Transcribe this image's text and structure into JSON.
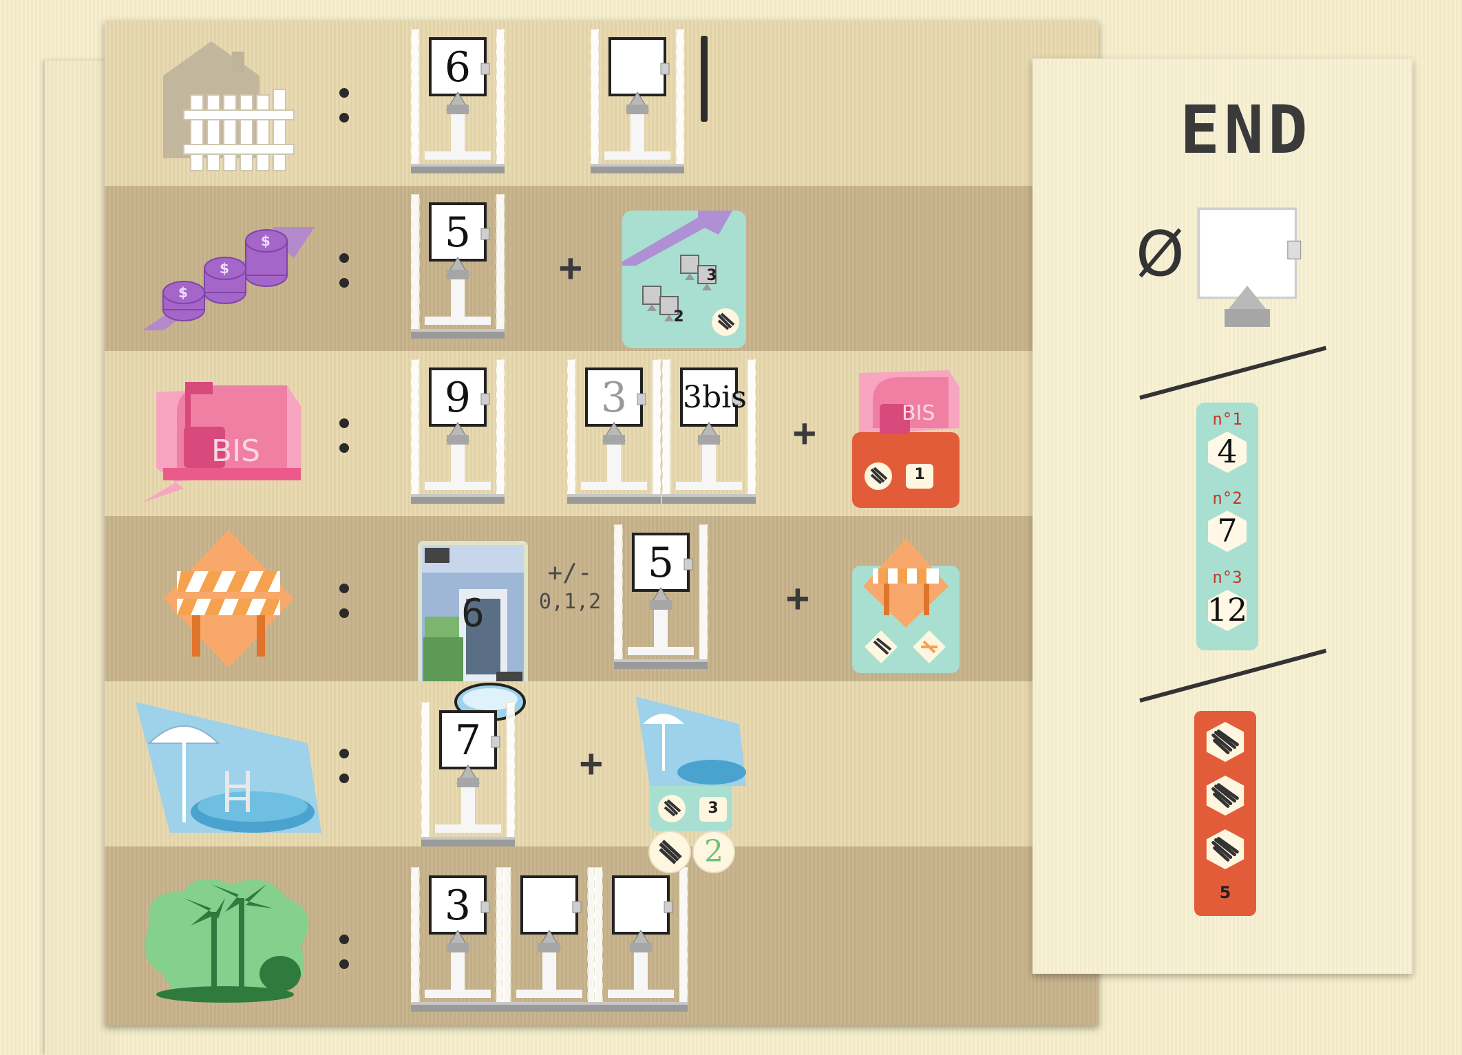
{
  "board": {
    "rows": [
      {
        "ability": "surveyor",
        "icon": "fence-house-icon",
        "houses": [
          {
            "number": "6"
          },
          {
            "number": ""
          }
        ],
        "extra": "fence-line"
      },
      {
        "ability": "real-estate-agent",
        "icon": "coins-arrow-icon",
        "houses": [
          {
            "number": "5"
          }
        ],
        "plus": "+",
        "bonus": {
          "values": [
            "3",
            "2"
          ]
        }
      },
      {
        "ability": "bis",
        "icon": "mailbox-bis-icon",
        "icon_text": "BIS",
        "houses": [
          {
            "number": "9"
          },
          {
            "number": "3"
          },
          {
            "number": "3bis"
          }
        ],
        "plus": "+",
        "bonus": {
          "icon_text": "BIS",
          "value": "1"
        }
      },
      {
        "ability": "temp-agent",
        "icon": "roadblock-icon",
        "card_number": "6",
        "modifier_sign": "+/-",
        "modifier_values": "0,1,2",
        "houses": [
          {
            "number": "5"
          }
        ],
        "plus": "+"
      },
      {
        "ability": "pool-manufacturer",
        "icon": "pool-umbrella-icon",
        "houses": [
          {
            "number": "7"
          }
        ],
        "plus": "+",
        "bonus": {
          "value": "3"
        }
      },
      {
        "ability": "landscaper",
        "icon": "palm-trees-icon",
        "houses": [
          {
            "number": "3"
          },
          {
            "number": ""
          },
          {
            "number": ""
          }
        ],
        "bonus": {
          "value": "2"
        }
      }
    ]
  },
  "end_panel": {
    "title": "END",
    "empty_symbol": "Ø",
    "goals": [
      {
        "label": "n°1",
        "value": "4"
      },
      {
        "label": "n°2",
        "value": "7"
      },
      {
        "label": "n°3",
        "value": "12"
      }
    ],
    "refusals": {
      "count_label": "5"
    }
  },
  "colors": {
    "teal": "#a8dfd0",
    "orange_red": "#e35c3a",
    "pink": "#ef7fa3",
    "purple": "#a566c9",
    "orange": "#f5a14e",
    "blue": "#9ed1ea",
    "green": "#6cc174"
  }
}
